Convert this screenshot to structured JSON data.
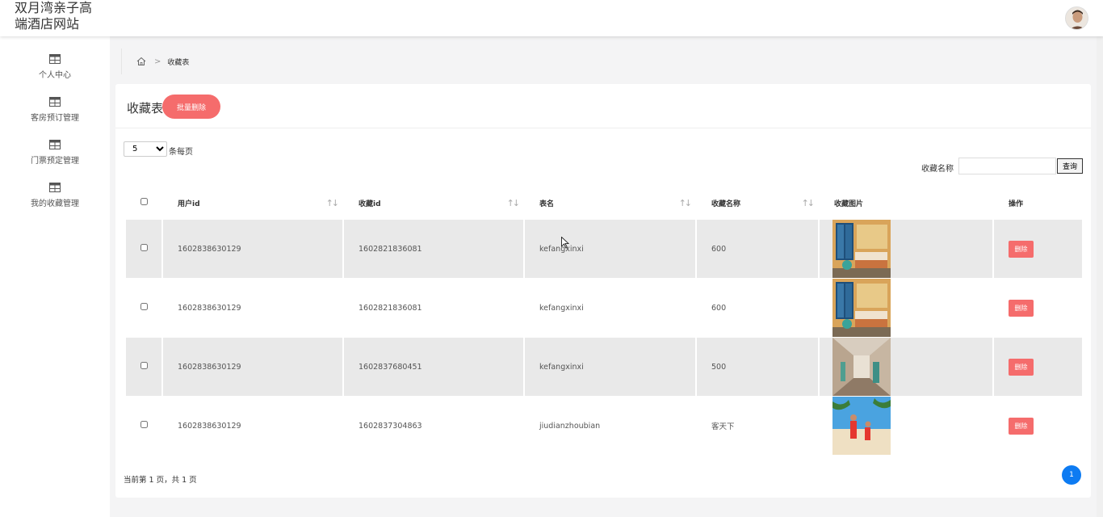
{
  "header": {
    "site_title": "双月湾亲子高端酒店网站"
  },
  "sidebar": {
    "items": [
      {
        "label": "个人中心",
        "icon": "table-icon"
      },
      {
        "label": "客房预订管理",
        "icon": "table-icon"
      },
      {
        "label": "门票预定管理",
        "icon": "table-icon"
      },
      {
        "label": "我的收藏管理",
        "icon": "table-icon"
      }
    ]
  },
  "breadcrumb": {
    "home_icon": "home-icon",
    "current": "收藏表"
  },
  "card": {
    "title": "收藏表",
    "batch_delete_label": "批量删除",
    "page_size_value": "5",
    "per_page_label": "条每页",
    "search": {
      "label": "收藏名称",
      "placeholder": "",
      "button_label": "查询"
    }
  },
  "table": {
    "headers": {
      "user_id": "用户id",
      "fav_id": "收藏id",
      "table_name": "表名",
      "fav_name": "收藏名称",
      "fav_image": "收藏图片",
      "actions": "操作"
    },
    "rows": [
      {
        "user_id": "1602838630129",
        "fav_id": "1602821836081",
        "table_name": "kefangxinxi",
        "fav_name": "600",
        "image": "hotel-room-image",
        "delete_label": "删除"
      },
      {
        "user_id": "1602838630129",
        "fav_id": "1602821836081",
        "table_name": "kefangxinxi",
        "fav_name": "600",
        "image": "hotel-room-image",
        "delete_label": "删除"
      },
      {
        "user_id": "1602838630129",
        "fav_id": "1602837680451",
        "table_name": "kefangxinxi",
        "fav_name": "500",
        "image": "hotel-corridor-image",
        "delete_label": "删除"
      },
      {
        "user_id": "1602838630129",
        "fav_id": "1602837304863",
        "table_name": "jiudianzhoubian",
        "fav_name": "客天下",
        "image": "beach-family-image",
        "delete_label": "删除"
      }
    ]
  },
  "pagination": {
    "info": "当前第 1 页，共 1 页",
    "current_page": "1"
  },
  "colors": {
    "danger": "#f56c6c",
    "primary": "#0d7bf2",
    "row_stripe": "#e9e9e9"
  }
}
